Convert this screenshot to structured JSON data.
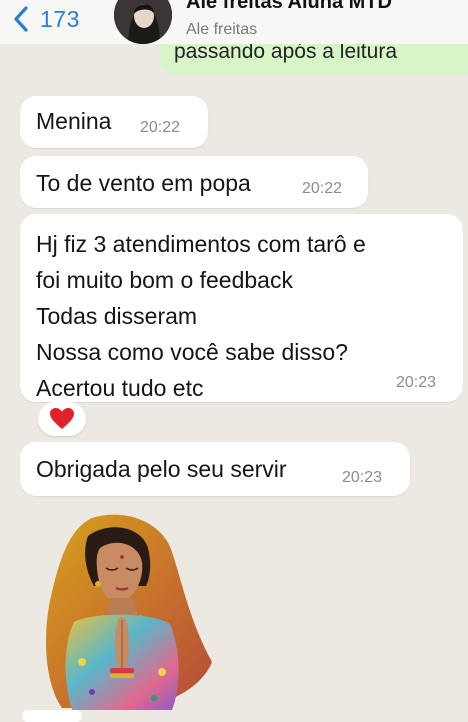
{
  "header": {
    "back_count": "173",
    "contact_name": "Ale freitas Aluna MTD",
    "contact_subtitle": "Ale freitas"
  },
  "outgoing_partial": {
    "text": "passando após a leitura"
  },
  "messages": [
    {
      "lines": [
        "Menina"
      ],
      "time": "20:22"
    },
    {
      "lines": [
        "To de vento em popa"
      ],
      "time": "20:22"
    },
    {
      "lines": [
        "Hj fiz 3 atendimentos com tarô e",
        "foi muito bom o feedback",
        "Todas disseram",
        "Nossa como você sabe disso?",
        "Acertou tudo etc"
      ],
      "time": "20:23"
    },
    {
      "lines": [
        "Obrigada pelo seu servir"
      ],
      "time": "20:23"
    }
  ],
  "reaction": {
    "icon": "heart-icon",
    "color": "#e0202b"
  },
  "colors": {
    "accent": "#2a7fd4",
    "outgoing_bubble": "#d8f5c8",
    "chat_background": "#ece9e3"
  }
}
